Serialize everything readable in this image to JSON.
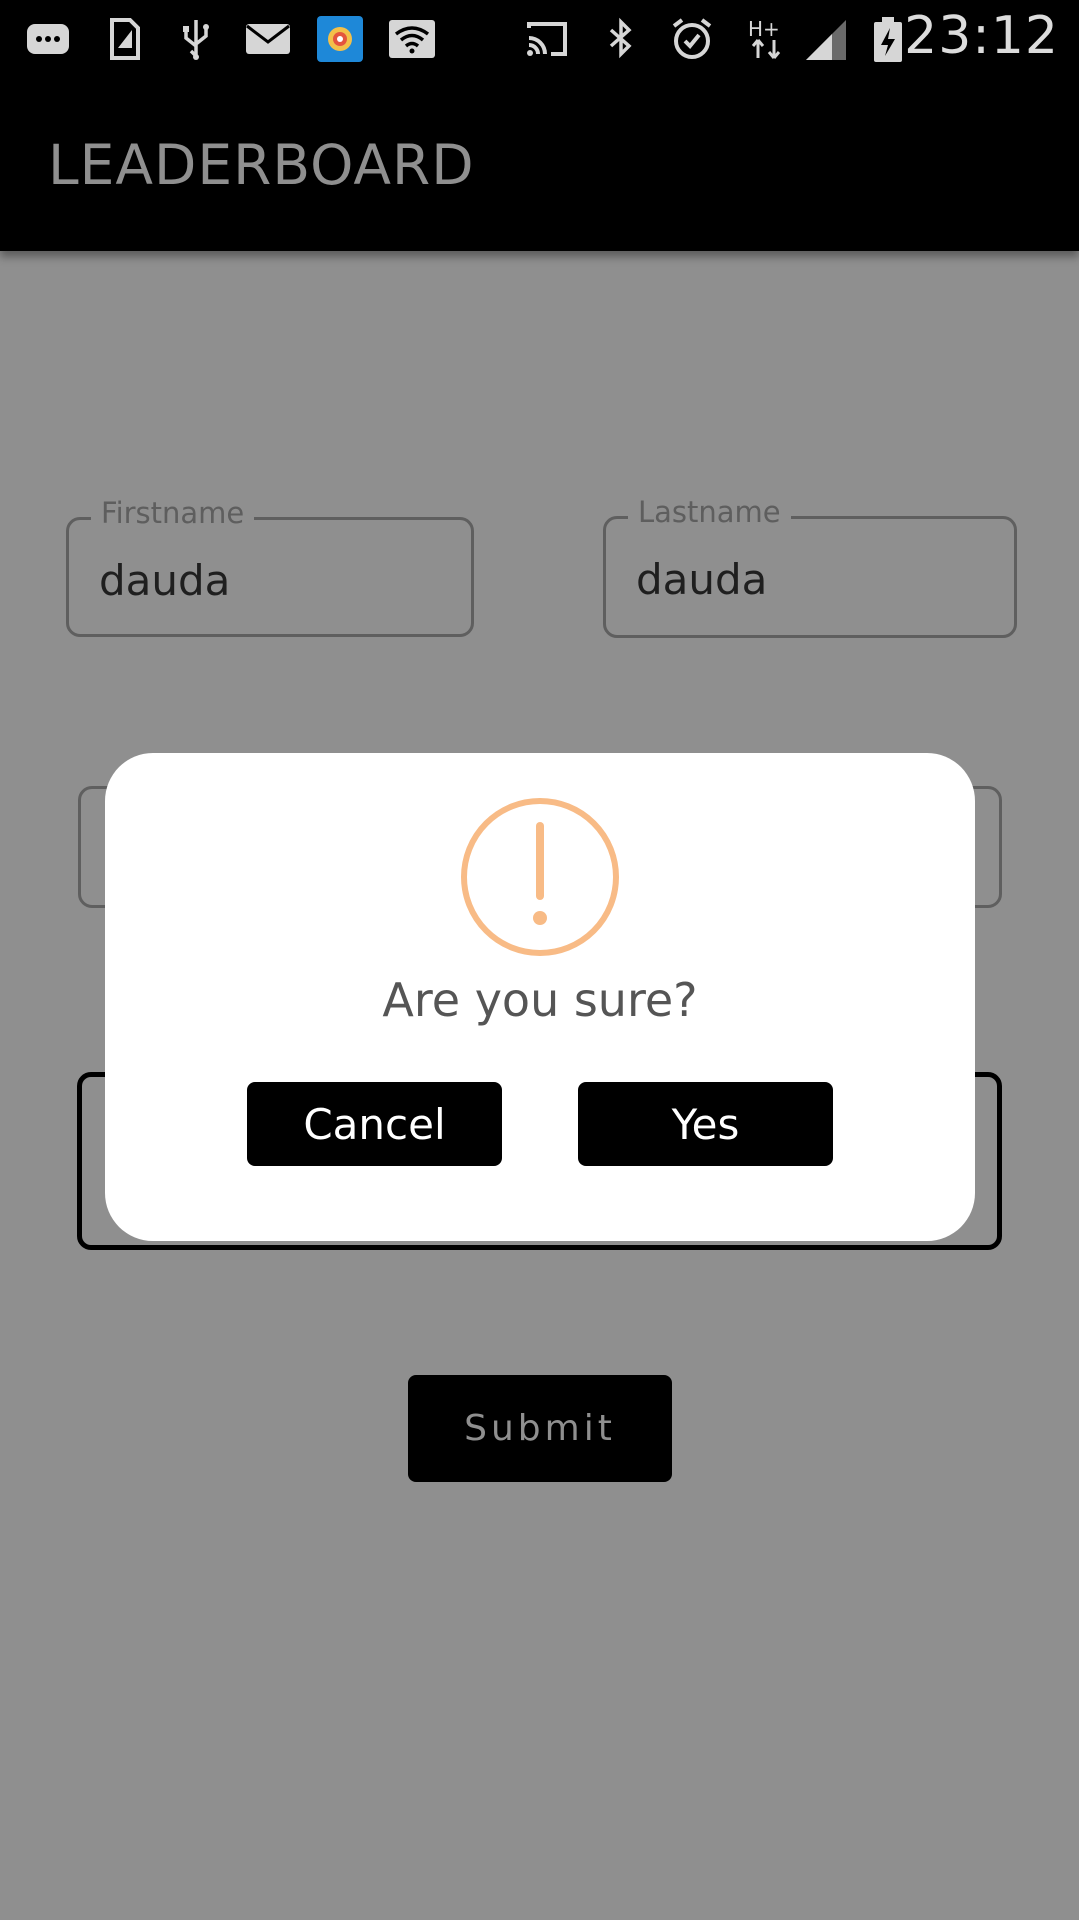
{
  "status_bar": {
    "time": "23:12",
    "network": "H+",
    "icons": [
      "more-icon",
      "sim-icon",
      "usb-icon",
      "mail-icon",
      "app-icon",
      "wifi-icon",
      "cast-icon",
      "bluetooth-icon",
      "alarm-icon",
      "network-type-icon",
      "signal-icon",
      "battery-icon"
    ]
  },
  "app_bar": {
    "title": "LEADERBOARD"
  },
  "form": {
    "firstname": {
      "label": "Firstname",
      "value": "dauda"
    },
    "lastname": {
      "label": "Lastname",
      "value": "dauda"
    },
    "submit_label": "Submit"
  },
  "dialog": {
    "icon": "warning-icon",
    "title": "Are you sure?",
    "cancel_label": "Cancel",
    "confirm_label": "Yes"
  },
  "colors": {
    "overlay": "#8f8f8f",
    "bar": "#000000",
    "warning": "#f8bb86",
    "dialog_bg": "#ffffff"
  }
}
